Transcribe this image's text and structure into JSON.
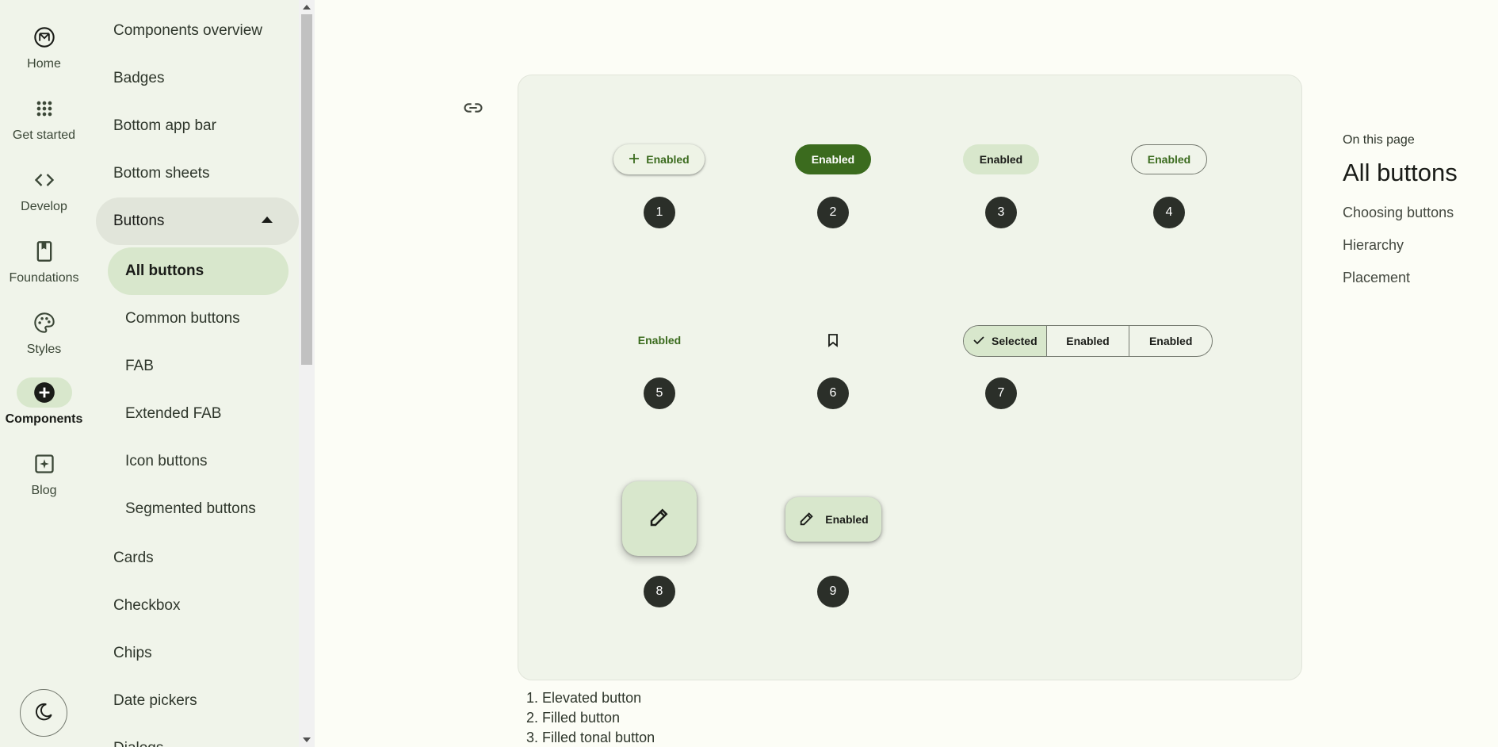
{
  "rail": {
    "items": [
      {
        "label": "Home",
        "icon": "material-logo-icon"
      },
      {
        "label": "Get started",
        "icon": "apps-grid-icon"
      },
      {
        "label": "Develop",
        "icon": "code-icon"
      },
      {
        "label": "Foundations",
        "icon": "book-icon"
      },
      {
        "label": "Styles",
        "icon": "palette-icon"
      },
      {
        "label": "Components",
        "icon": "add-circle-icon",
        "active": true
      },
      {
        "label": "Blog",
        "icon": "blog-icon"
      }
    ],
    "theme_toggle_icon": "moon-icon"
  },
  "subnav": {
    "items_top": [
      "Components overview",
      "Badges",
      "Bottom app bar",
      "Bottom sheets"
    ],
    "group": {
      "label": "Buttons",
      "expanded": true
    },
    "children": [
      "All buttons",
      "Common buttons",
      "FAB",
      "Extended FAB",
      "Icon buttons",
      "Segmented buttons"
    ],
    "selected": "All buttons",
    "items_bottom": [
      "Cards",
      "Checkbox",
      "Chips",
      "Date pickers",
      "Dialogs"
    ]
  },
  "demo": {
    "elevated_label": "Enabled",
    "filled_label": "Enabled",
    "tonal_label": "Enabled",
    "outlined_label": "Enabled",
    "text_label": "Enabled",
    "segmented": [
      "Selected",
      "Enabled",
      "Enabled"
    ],
    "ext_fab_label": "Enabled",
    "markers": [
      "1",
      "2",
      "3",
      "4",
      "5",
      "6",
      "7",
      "8",
      "9"
    ]
  },
  "legend": [
    "1. Elevated button",
    "2. Filled button",
    "3. Filled tonal button"
  ],
  "toc": {
    "eyebrow": "On this page",
    "title": "All buttons",
    "links": [
      "Choosing buttons",
      "Hierarchy",
      "Placement"
    ]
  },
  "colors": {
    "primary": "#3b6b1e",
    "secondary_container": "#d8e7cc",
    "surface": "#fcfdf6",
    "surface_container": "#f0f4ea"
  }
}
